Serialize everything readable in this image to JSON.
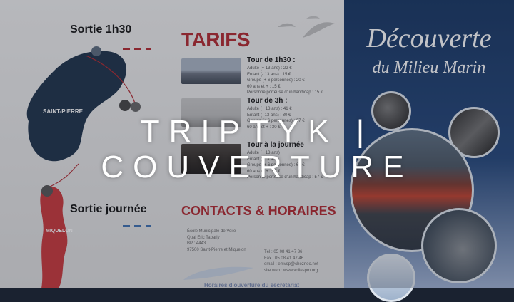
{
  "left": {
    "sortie_1": "Sortie 1h30",
    "sortie_2": "Sortie journée",
    "island_1": "SAINT-PIERRE",
    "island_2": "MIQUELON"
  },
  "tarifs": {
    "title": "TARIFS",
    "tours": [
      {
        "title": "Tour de 1h30 :",
        "lines": [
          "Adulte (+ 13 ans) : 22 €",
          "Enfant (- 13 ans) : 15 €",
          "Groupe (+ 6 personnes) : 20 €",
          "60 ans et + : 15 €",
          "Personne porteuse d'un handicap : 15 €"
        ]
      },
      {
        "title": "Tour de 3h :",
        "lines": [
          "Adulte (+ 13 ans) : 41 €",
          "Enfant (- 13 ans) : 30 €",
          "Groupe (+ 6 personnes) : 37 €",
          "60 ans et + : 30 €"
        ]
      },
      {
        "title": "Tour à la journée",
        "lines": [
          "Adulte (+ 13 ans)",
          "Enfant (- 13 ans)",
          "Groupe (+ 6 personnes) : 60 €",
          "60 ans et + : 57 €",
          "Personne porteuse d'un handicap : 57 €"
        ]
      }
    ]
  },
  "contacts": {
    "title": "CONTACTS & HORAIRES",
    "address": [
      "École Municipale de Voile",
      "Quai Eric Tabarly",
      "BP : 4443",
      "97500 Saint-Pierre et Miquelon"
    ],
    "phone": "Tél : 05 08 41 47 36",
    "fax": "Fax : 05 08 41 47 46",
    "email": "email : emvsp@cheznoo.net",
    "web": "site web : www.voilespm.org",
    "footer": "Horaires d'ouverture du secrétariat"
  },
  "cover": {
    "title_line1": "Découverte",
    "title_line2": "du Milieu Marin"
  },
  "banner": {
    "text": "TRIPTYK | COUVERTURE"
  },
  "colors": {
    "accent_red": "#b2282e",
    "navy": "#163562",
    "dash_blue": "#3c6fb0"
  }
}
